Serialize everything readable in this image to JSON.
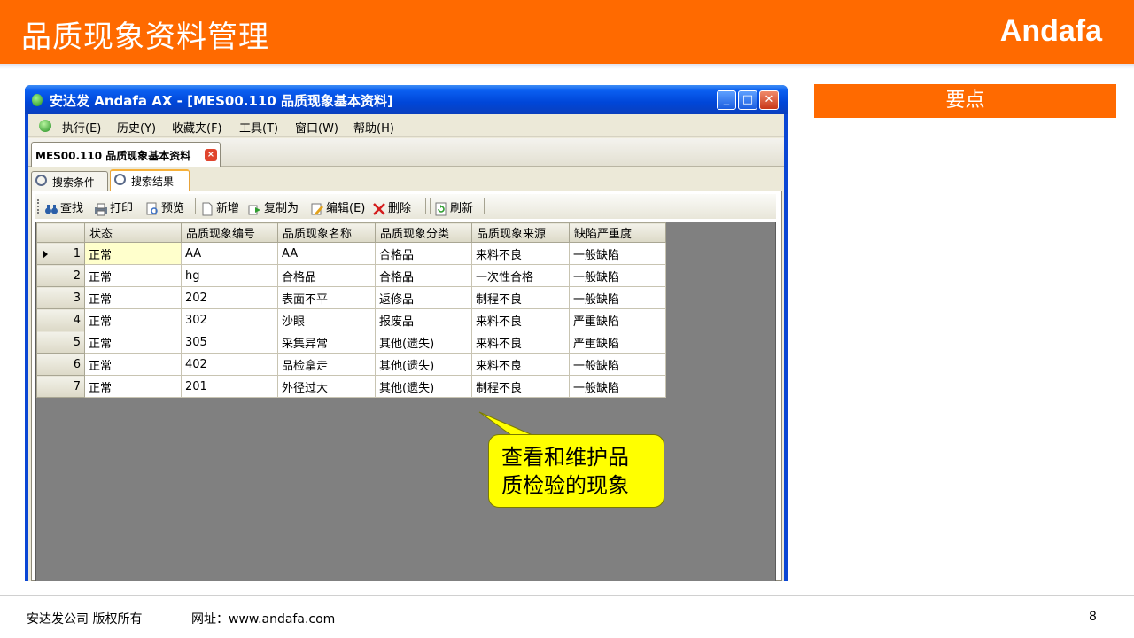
{
  "slide": {
    "title": "品质现象资料管理",
    "brand": "Andafa",
    "keypoint_label": "要点"
  },
  "window": {
    "title": "安达发 Andafa AX - [MES00.110 品质现象基本资料]"
  },
  "menu": {
    "items": [
      "执行(E)",
      "历史(Y)",
      "收藏夹(F)",
      "工具(T)",
      "窗口(W)",
      "帮助(H)"
    ]
  },
  "doc_tab": {
    "label": "MES00.110 品质现象基本资料"
  },
  "subtabs": [
    "搜索条件",
    "搜索结果"
  ],
  "toolbar": {
    "items": [
      "查找",
      "打印",
      "预览",
      "新增",
      "复制为",
      "编辑(E)",
      "删除",
      "刷新"
    ]
  },
  "grid": {
    "columns": [
      "状态",
      "品质现象编号",
      "品质现象名称",
      "品质现象分类",
      "品质现象来源",
      "缺陷严重度"
    ],
    "rows": [
      {
        "no": "1",
        "cells": [
          "正常",
          "AA",
          "AA",
          "合格品",
          "来料不良",
          "一般缺陷"
        ]
      },
      {
        "no": "2",
        "cells": [
          "正常",
          "hg",
          "合格品",
          "合格品",
          "一次性合格",
          "一般缺陷"
        ]
      },
      {
        "no": "3",
        "cells": [
          "正常",
          "202",
          "表面不平",
          "返修品",
          "制程不良",
          "一般缺陷"
        ]
      },
      {
        "no": "4",
        "cells": [
          "正常",
          "302",
          "沙眼",
          "报废品",
          "来料不良",
          "严重缺陷"
        ]
      },
      {
        "no": "5",
        "cells": [
          "正常",
          "305",
          "采集异常",
          "其他(遗失)",
          "来料不良",
          "严重缺陷"
        ]
      },
      {
        "no": "6",
        "cells": [
          "正常",
          "402",
          "品检拿走",
          "其他(遗失)",
          "来料不良",
          "一般缺陷"
        ]
      },
      {
        "no": "7",
        "cells": [
          "正常",
          "201",
          "外径过大",
          "其他(遗失)",
          "制程不良",
          "一般缺陷"
        ]
      }
    ]
  },
  "callout": {
    "line1": "查看和维护品",
    "line2": "质检验的现象"
  },
  "footer": {
    "copyright": "安达发公司 版权所有",
    "website": "网址：www.andafa.com",
    "page": "8"
  },
  "colors": {
    "accent": "#ff6a00",
    "callout": "#ffff00",
    "titlebar": "#0046d8"
  }
}
